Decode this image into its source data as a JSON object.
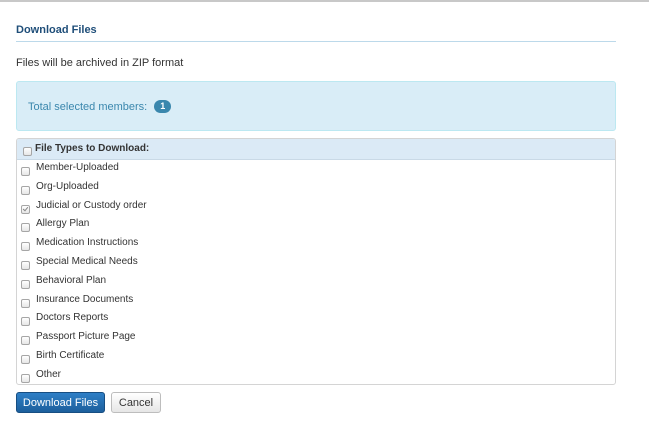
{
  "dialog": {
    "title": "Download Files",
    "subtitle": "Files will be archived in ZIP format"
  },
  "info": {
    "label": "Total selected members:",
    "count": "1"
  },
  "file_types": {
    "header": "File Types to Download:",
    "header_checked": false,
    "items": [
      {
        "label": "Member-Uploaded",
        "checked": false
      },
      {
        "label": "Org-Uploaded",
        "checked": false
      },
      {
        "label": "Judicial or Custody order",
        "checked": true
      },
      {
        "label": "Allergy Plan",
        "checked": false
      },
      {
        "label": "Medication Instructions",
        "checked": false
      },
      {
        "label": "Special Medical Needs",
        "checked": false
      },
      {
        "label": "Behavioral Plan",
        "checked": false
      },
      {
        "label": "Insurance Documents",
        "checked": false
      },
      {
        "label": "Doctors Reports",
        "checked": false
      },
      {
        "label": "Passport Picture Page",
        "checked": false
      },
      {
        "label": "Birth Certificate",
        "checked": false
      },
      {
        "label": "Other",
        "checked": false
      }
    ]
  },
  "buttons": {
    "download_label": "Download Files",
    "cancel_label": "Cancel"
  },
  "colors": {
    "title": "#1f4e79",
    "info_bg": "#d9edf7",
    "info_text": "#3a87ad",
    "primary_button": "#1d5f9c"
  }
}
